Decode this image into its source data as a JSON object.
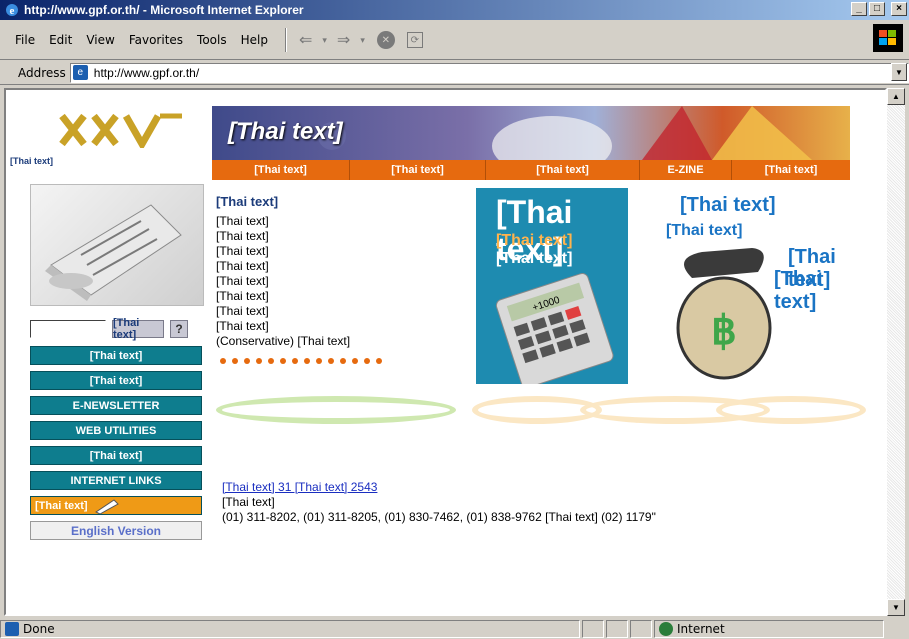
{
  "window": {
    "title": "http://www.gpf.or.th/ - Microsoft Internet Explorer",
    "minimize": "_",
    "maximize": "□",
    "close": "×"
  },
  "menu": {
    "items": [
      {
        "label": "File"
      },
      {
        "label": "Edit"
      },
      {
        "label": "View"
      },
      {
        "label": "Favorites"
      },
      {
        "label": "Tools"
      },
      {
        "label": "Help"
      }
    ]
  },
  "toolbar": {
    "back": "⇐",
    "forward": "⇒",
    "dropdown": "▾",
    "stop": "✕",
    "refresh": "⟳"
  },
  "address": {
    "label": "Address",
    "url": "http://www.gpf.or.th/",
    "dropdown": "▼"
  },
  "page": {
    "logo_text": "[Thai text]",
    "banner_greeting": "[Thai text]",
    "nav": [
      {
        "label": "[Thai text]"
      },
      {
        "label": "[Thai text]"
      },
      {
        "label": "[Thai text]"
      },
      {
        "label": "E-ZINE"
      },
      {
        "label": "[Thai text]"
      }
    ],
    "headline": "[Thai text]",
    "body_lines": [
      "[Thai text]",
      "[Thai text]",
      "[Thai text]",
      "[Thai text]",
      "[Thai text]",
      "[Thai text]",
      "[Thai text]",
      "[Thai text]",
      "(Conservative) [Thai text]"
    ],
    "calc_promo": {
      "big": "[Thai text]",
      "sub1": "[Thai text]",
      "sub2": "[Thai text]",
      "calc_display": "+1000"
    },
    "invest_promo": {
      "t1": "[Thai text]",
      "t2": "[Thai text]",
      "t3": "[Thai text]",
      "t4": "[Thai text]",
      "bag_symbol": "฿"
    },
    "search": {
      "button": "[Thai text]",
      "help": "?"
    },
    "side_menu": [
      {
        "label": "[Thai text]",
        "style": "teal"
      },
      {
        "label": "[Thai text]",
        "style": "teal"
      },
      {
        "label": "E-NEWSLETTER",
        "style": "teal"
      },
      {
        "label": "WEB UTILITIES",
        "style": "teal"
      },
      {
        "label": "[Thai text]",
        "style": "teal"
      },
      {
        "label": "INTERNET LINKS",
        "style": "teal"
      },
      {
        "label": "[Thai text]",
        "style": "orange"
      },
      {
        "label": "English Version",
        "style": "english"
      }
    ],
    "notice": {
      "link": "[Thai text] 31 [Thai text] 2543",
      "line2": "[Thai text]",
      "line3": "(01) 311-8202, (01) 311-8205, (01) 830-7462, (01) 838-9762 [Thai text] (02) 1179\""
    }
  },
  "status": {
    "text": "Done",
    "zone": "Internet"
  },
  "colors": {
    "nav_orange": "#e66a0f",
    "side_teal": "#0e7d8e",
    "link_blue": "#1a2ec0",
    "title_blue": "#0a246a"
  }
}
